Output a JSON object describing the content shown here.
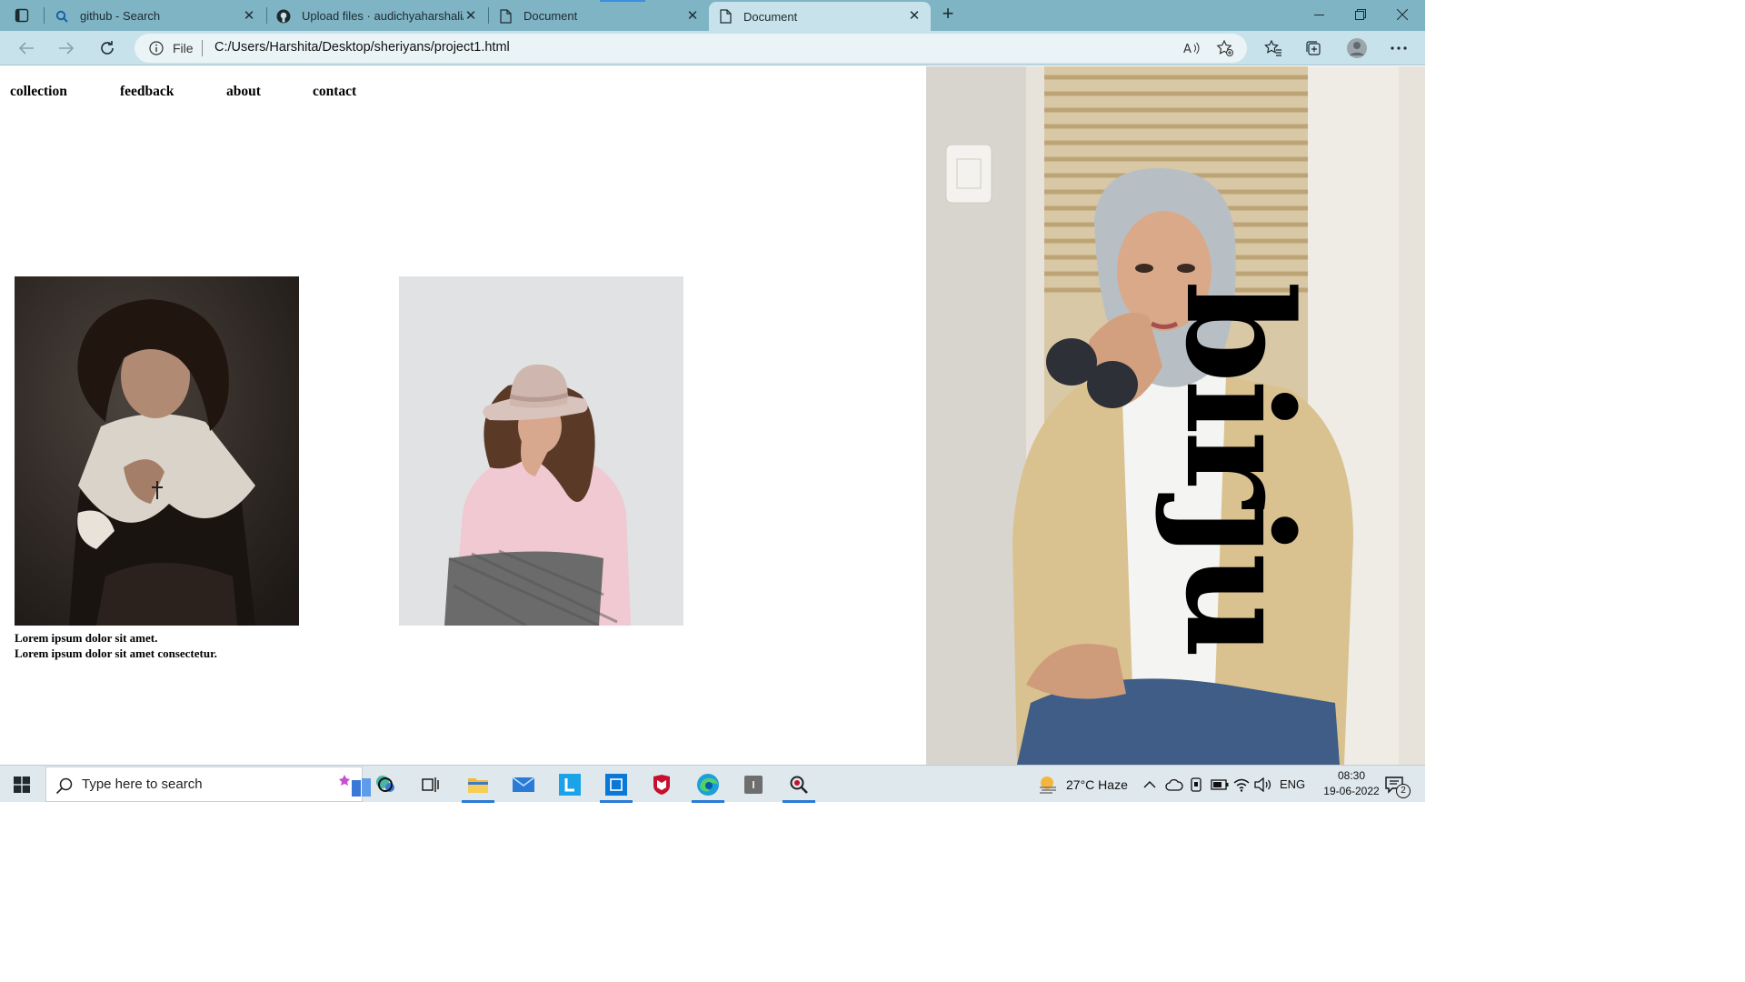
{
  "browser": {
    "tabs": [
      {
        "title": "github - Search",
        "icon": "search-icon"
      },
      {
        "title": "Upload files · audichyaharshali/r",
        "icon": "github-icon"
      },
      {
        "title": "Document",
        "icon": "document-icon"
      },
      {
        "title": "Document",
        "icon": "document-icon",
        "active": true
      }
    ],
    "address": {
      "scheme_label": "File",
      "url": "C:/Users/Harshita/Desktop/sheriyans/project1.html"
    }
  },
  "page": {
    "nav": [
      "collection",
      "feedback",
      "about",
      "contact"
    ],
    "caption": {
      "line1": "Lorem ipsum dolor sit amet.",
      "line2": "Lorem ipsum dolor sit amet consectetur."
    },
    "brand": "birju"
  },
  "taskbar": {
    "search_placeholder": "Type here to search",
    "weather": "27°C  Haze",
    "language": "ENG",
    "time": "08:30",
    "date": "19-06-2022",
    "notifications": "2"
  },
  "colors": {
    "tab_strip": "#7fb4c4",
    "toolbar": "#c7e2ea",
    "taskbar": "#dfe8ec",
    "accent": "#2a7bd6"
  }
}
